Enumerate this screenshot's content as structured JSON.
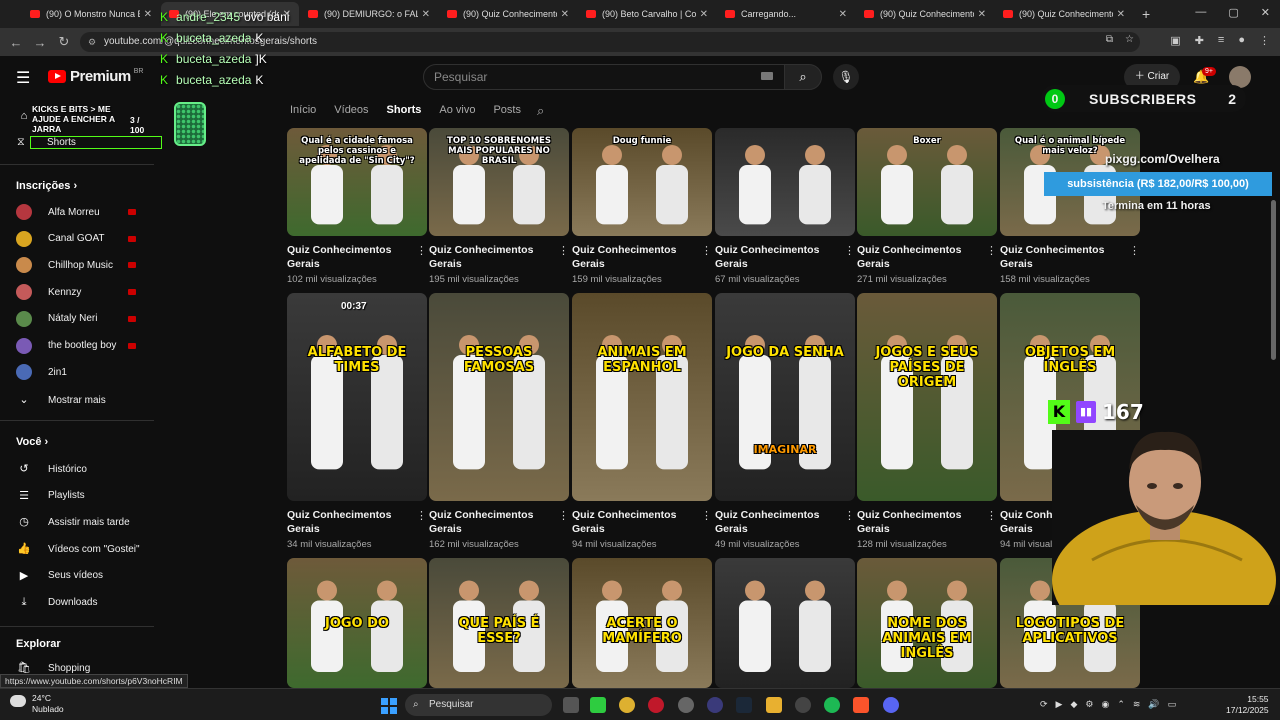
{
  "browser": {
    "tabs": [
      {
        "title": "(90) O Monstro Nunca Es"
      },
      {
        "title": "(90) Ele em counted (de"
      },
      {
        "title": "(90) DEMIURGO: o FALSO"
      },
      {
        "title": "(90) Quiz Conhecimentos"
      },
      {
        "title": "(90) Beto Carvalho | Conh"
      },
      {
        "title": "Carregando..."
      },
      {
        "title": "(90) Quiz Conhecimentos"
      },
      {
        "title": "(90) Quiz Conhecimentos"
      }
    ],
    "new_tab": "+",
    "url": "youtube.com/@quizconhecimentosgerais/shorts",
    "status_url": "https://www.youtube.com/shorts/p6V3noHcRIM"
  },
  "youtube": {
    "logo": "Premium",
    "region": "BR",
    "search_placeholder": "Pesquisar",
    "create_label": "Criar",
    "notif_count": "9+"
  },
  "sidebar": {
    "overlay_title": "KICKS E BITS > ME AJUDE A ENCHER A JARRA",
    "jar_count": "3 / 100",
    "shorts_label": "Shorts",
    "subs_heading": "Inscrições",
    "subscriptions": [
      {
        "name": "Alfa Morreu",
        "color": "#b5373f"
      },
      {
        "name": "Canal GOAT",
        "color": "#d9a520"
      },
      {
        "name": "Chillhop Music",
        "color": "#c98a4b"
      },
      {
        "name": "Kennzy",
        "color": "#c45a5a"
      },
      {
        "name": "Nátaly Neri",
        "color": "#5a8a4b"
      },
      {
        "name": "the bootleg boy",
        "color": "#7a5ab5"
      },
      {
        "name": "2in1",
        "color": "#4a6ab5"
      }
    ],
    "show_more": "Mostrar mais",
    "you_heading": "Você",
    "you_items": [
      "Histórico",
      "Playlists",
      "Assistir mais tarde",
      "Vídeos com \"Gostei\"",
      "Seus vídeos",
      "Downloads"
    ],
    "explore_heading": "Explorar",
    "explore_items": [
      "Shopping"
    ]
  },
  "channel_tabs": [
    "Início",
    "Vídeos",
    "Shorts",
    "Ao vivo",
    "Posts"
  ],
  "shorts": [
    {
      "title": "Quiz Conhecimentos Gerais",
      "views": "102 mil visualizações",
      "caption": "Qual é a cidade famosa pelos cassinos e apelidada de \"Sin City\"?"
    },
    {
      "title": "Quiz Conhecimentos Gerais",
      "views": "195 mil visualizações",
      "caption": "TOP 10 SOBRENOMES MAIS POPULARES NO BRASIL"
    },
    {
      "title": "Quiz Conhecimentos Gerais",
      "views": "159 mil visualizações",
      "caption": "Doug funnie"
    },
    {
      "title": "Quiz Conhecimentos Gerais",
      "views": "67 mil visualizações",
      "caption": ""
    },
    {
      "title": "Quiz Conhecimentos Gerais",
      "views": "271 mil visualizações",
      "caption": "Boxer"
    },
    {
      "title": "Quiz Conhecimentos Gerais",
      "views": "158 mil visualizações",
      "caption": "Qual é o animal bípede mais veloz?"
    },
    {
      "title": "Quiz Conhecimentos Gerais",
      "views": "34 mil visualizações",
      "caption": "ALFABETO DE TIMES",
      "duration": "00:37"
    },
    {
      "title": "Quiz Conhecimentos Gerais",
      "views": "162 mil visualizações",
      "caption": "PESSOAS FAMOSAS"
    },
    {
      "title": "Quiz Conhecimentos Gerais",
      "views": "94 mil visualizações",
      "caption": "ANIMAIS EM ESPANHOL"
    },
    {
      "title": "Quiz Conhecimentos Gerais",
      "views": "49 mil visualizações",
      "caption": "JOGO DA SENHA",
      "caption2": "IMAGINAR"
    },
    {
      "title": "Quiz Conhecimentos Gerais",
      "views": "128 mil visualizações",
      "caption": "JOGOS E SEUS PAÍSES DE ORIGEM"
    },
    {
      "title": "Quiz Conhecimentos Gerais",
      "views": "94 mil visualizações",
      "caption": "OBJETOS EM INGLÊS"
    },
    {
      "caption": "JOGO DO"
    },
    {
      "caption": "QUE PAÍS É ESSE?"
    },
    {
      "caption": "ACERTE O MAMÍFERO"
    },
    {
      "caption": ""
    },
    {
      "caption": "NOME DOS ANIMAIS EM INGLÊS"
    },
    {
      "caption": "LOGOTIPOS DE APLICATIVOS"
    }
  ],
  "stream_overlay": {
    "chat": [
      {
        "user": "andre_2345",
        "msg": "ovo bani"
      },
      {
        "user": "buceta_azeda",
        "msg": "K"
      },
      {
        "user": "buceta_azeda",
        "msg": "]K"
      },
      {
        "user": "buceta_azeda",
        "msg": "K"
      }
    ],
    "subscribers_left": "0",
    "subscribers_label": "SUBSCRIBERS",
    "subscribers_right": "2",
    "goal_url": "pixgg.com/Ovelhera",
    "goal_text": "subsistência (R$ 182,00/R$ 100,00)",
    "goal_time": "Termina em 11 horas",
    "viewer_count": "167"
  },
  "taskbar": {
    "temp": "24°C",
    "weather": "Nublado",
    "search": "Pesquisar",
    "time": "15:55",
    "date": "17/12/2025"
  }
}
